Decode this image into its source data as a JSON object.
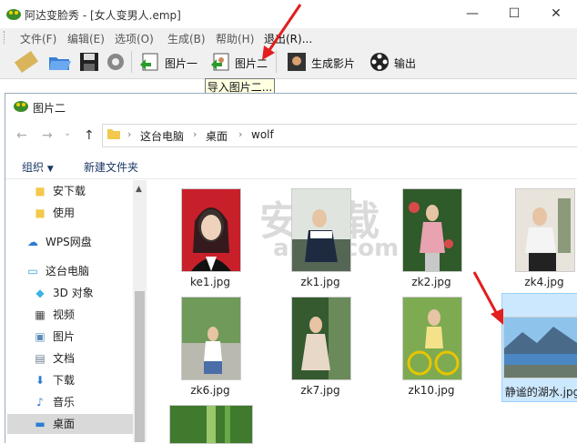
{
  "app": {
    "title": "阿达变脸秀 - [女人变男人.emp]",
    "menu": [
      "文件(F)",
      "编辑(E)",
      "选项(O)",
      "生成(B)",
      "帮助(H)",
      "退出(R)..."
    ],
    "toolbar": {
      "pic1": "图片一",
      "pic2": "图片二",
      "generate": "生成影片",
      "output": "输出"
    },
    "tooltip": "导入图片二..."
  },
  "dialog": {
    "title": "图片二",
    "breadcrumb": [
      "这台电脑",
      "桌面",
      "wolf"
    ],
    "commands": {
      "organize": "组织",
      "new_folder": "新建文件夹"
    },
    "nav_items": [
      {
        "label": "安下载",
        "icon": "folder-icon"
      },
      {
        "label": "使用",
        "icon": "folder-icon"
      },
      {
        "label": "WPS网盘",
        "icon": "cloud-icon"
      },
      {
        "label": "这台电脑",
        "icon": "computer-icon"
      },
      {
        "label": "3D 对象",
        "icon": "cube-icon"
      },
      {
        "label": "视频",
        "icon": "video-icon"
      },
      {
        "label": "图片",
        "icon": "picture-icon"
      },
      {
        "label": "文档",
        "icon": "document-icon"
      },
      {
        "label": "下载",
        "icon": "download-icon"
      },
      {
        "label": "音乐",
        "icon": "music-icon"
      },
      {
        "label": "桌面",
        "icon": "desktop-icon"
      }
    ],
    "files": [
      {
        "name": "ke1.jpg"
      },
      {
        "name": "zk1.jpg"
      },
      {
        "name": "zk2.jpg"
      },
      {
        "name": "zk4.jpg"
      },
      {
        "name": "zk6.jpg"
      },
      {
        "name": "zk7.jpg"
      },
      {
        "name": "zk10.jpg"
      },
      {
        "name": "静谧的湖水.jpg"
      }
    ]
  },
  "watermark": {
    "line1": "安下载",
    "line2": "anxz.com"
  }
}
